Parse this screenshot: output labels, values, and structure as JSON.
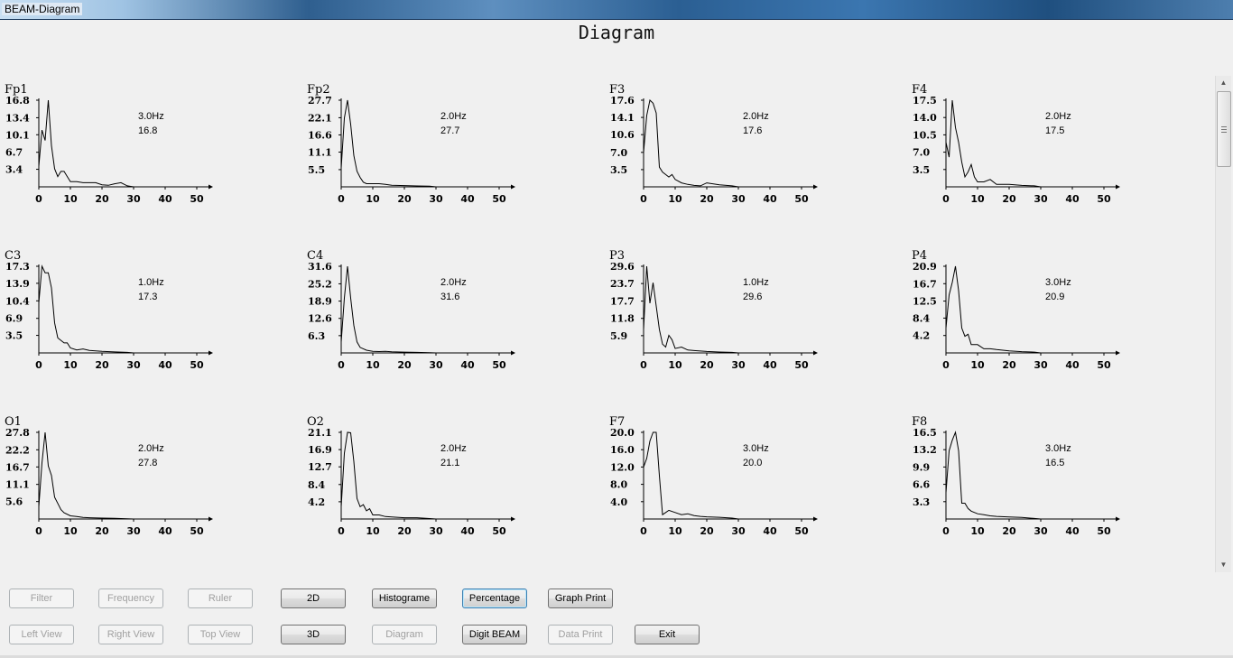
{
  "window": {
    "title": "BEAM-Diagram"
  },
  "page": {
    "title": "Diagram"
  },
  "x_tick_labels": [
    "0",
    "10",
    "20",
    "30",
    "40",
    "50"
  ],
  "chart_data": [
    {
      "type": "line",
      "channel": "Fp1",
      "peak_label": "3.0Hz",
      "peak_value": "16.8",
      "ymax": 16.8,
      "y_ticks": [
        "16.8",
        "13.4",
        "10.1",
        "6.7",
        "3.4"
      ],
      "x": [
        0,
        1,
        2,
        3,
        4,
        5,
        6,
        7,
        8,
        9,
        10,
        12,
        14,
        16,
        18,
        20,
        22,
        24,
        26,
        28,
        30
      ],
      "values": [
        4.0,
        11.0,
        9.0,
        16.8,
        8.0,
        3.5,
        2.0,
        3.0,
        3.0,
        2.0,
        1.0,
        1.0,
        0.8,
        0.8,
        0.8,
        0.4,
        0.3,
        0.6,
        0.8,
        0.2,
        0.0
      ]
    },
    {
      "type": "line",
      "channel": "Fp2",
      "peak_label": "2.0Hz",
      "peak_value": "27.7",
      "ymax": 27.7,
      "y_ticks": [
        "27.7",
        "22.1",
        "16.6",
        "11.1",
        "5.5"
      ],
      "x": [
        0,
        1,
        2,
        3,
        4,
        5,
        6,
        7,
        8,
        10,
        12,
        14,
        16,
        20,
        24,
        28,
        30
      ],
      "values": [
        6.0,
        22.0,
        27.7,
        20.0,
        10.0,
        5.0,
        3.0,
        1.5,
        1.0,
        1.0,
        1.0,
        0.8,
        0.5,
        0.4,
        0.3,
        0.2,
        0.0
      ]
    },
    {
      "type": "line",
      "channel": "F3",
      "peak_label": "2.0Hz",
      "peak_value": "17.6",
      "ymax": 17.6,
      "y_ticks": [
        "17.6",
        "14.1",
        "10.6",
        "7.0",
        "3.5"
      ],
      "x": [
        0,
        1,
        2,
        3,
        4,
        5,
        6,
        7,
        8,
        9,
        10,
        12,
        14,
        16,
        18,
        20,
        24,
        28,
        30
      ],
      "values": [
        7.0,
        14.5,
        17.6,
        17.0,
        15.0,
        4.0,
        3.0,
        2.5,
        2.0,
        2.5,
        1.5,
        0.8,
        0.5,
        0.3,
        0.2,
        0.8,
        0.4,
        0.2,
        0.0
      ]
    },
    {
      "type": "line",
      "channel": "F4",
      "peak_label": "2.0Hz",
      "peak_value": "17.5",
      "ymax": 17.5,
      "y_ticks": [
        "17.5",
        "14.0",
        "10.5",
        "7.0",
        "3.5"
      ],
      "x": [
        0,
        1,
        2,
        3,
        4,
        5,
        6,
        7,
        8,
        9,
        10,
        12,
        14,
        16,
        18,
        20,
        24,
        28,
        30
      ],
      "values": [
        9.0,
        6.0,
        17.5,
        12.0,
        9.0,
        5.0,
        2.0,
        3.0,
        4.5,
        2.0,
        1.0,
        1.0,
        1.5,
        0.5,
        0.5,
        0.5,
        0.3,
        0.2,
        0.0
      ]
    },
    {
      "type": "line",
      "channel": "C3",
      "peak_label": "1.0Hz",
      "peak_value": "17.3",
      "ymax": 17.3,
      "y_ticks": [
        "17.3",
        "13.9",
        "10.4",
        "6.9",
        "3.5"
      ],
      "x": [
        0,
        1,
        2,
        3,
        4,
        5,
        6,
        7,
        8,
        9,
        10,
        12,
        14,
        16,
        20,
        24,
        28,
        30
      ],
      "values": [
        10.0,
        17.3,
        16.0,
        16.0,
        13.0,
        6.0,
        3.0,
        2.5,
        2.0,
        2.0,
        1.0,
        0.6,
        0.8,
        0.5,
        0.3,
        0.2,
        0.1,
        0.0
      ]
    },
    {
      "type": "line",
      "channel": "C4",
      "peak_label": "2.0Hz",
      "peak_value": "31.6",
      "ymax": 31.6,
      "y_ticks": [
        "31.6",
        "25.2",
        "18.9",
        "12.6",
        "6.3"
      ],
      "x": [
        0,
        1,
        2,
        3,
        4,
        5,
        6,
        8,
        10,
        12,
        14,
        16,
        20,
        24,
        28,
        30
      ],
      "values": [
        4.0,
        20.0,
        31.6,
        20.0,
        10.0,
        4.0,
        2.0,
        1.0,
        0.6,
        0.5,
        0.6,
        0.4,
        0.3,
        0.2,
        0.1,
        0.0
      ]
    },
    {
      "type": "line",
      "channel": "P3",
      "peak_label": "1.0Hz",
      "peak_value": "29.6",
      "ymax": 29.6,
      "y_ticks": [
        "29.6",
        "23.7",
        "17.7",
        "11.8",
        "5.9"
      ],
      "x": [
        0,
        1,
        2,
        3,
        4,
        5,
        6,
        7,
        8,
        9,
        10,
        12,
        14,
        16,
        20,
        24,
        28,
        30
      ],
      "values": [
        8.0,
        29.6,
        17.0,
        24.0,
        16.0,
        8.0,
        3.0,
        2.0,
        6.0,
        4.5,
        1.5,
        2.0,
        1.0,
        0.8,
        0.5,
        0.3,
        0.2,
        0.0
      ]
    },
    {
      "type": "line",
      "channel": "P4",
      "peak_label": "3.0Hz",
      "peak_value": "20.9",
      "ymax": 20.9,
      "y_ticks": [
        "20.9",
        "16.7",
        "12.5",
        "8.4",
        "4.2"
      ],
      "x": [
        0,
        1,
        2,
        3,
        4,
        5,
        6,
        7,
        8,
        10,
        12,
        14,
        16,
        20,
        24,
        28,
        30
      ],
      "values": [
        6.0,
        14.0,
        17.0,
        20.9,
        15.0,
        6.0,
        4.0,
        4.5,
        2.0,
        2.0,
        1.0,
        1.0,
        0.8,
        0.5,
        0.3,
        0.2,
        0.0
      ]
    },
    {
      "type": "line",
      "channel": "O1",
      "peak_label": "2.0Hz",
      "peak_value": "27.8",
      "ymax": 27.8,
      "y_ticks": [
        "27.8",
        "22.2",
        "16.7",
        "11.1",
        "5.6"
      ],
      "x": [
        0,
        1,
        2,
        3,
        4,
        5,
        6,
        7,
        8,
        10,
        12,
        14,
        16,
        20,
        24,
        28,
        30
      ],
      "values": [
        4.0,
        18.0,
        27.8,
        17.0,
        14.0,
        7.0,
        5.0,
        3.0,
        2.0,
        1.0,
        0.8,
        0.5,
        0.4,
        0.3,
        0.2,
        0.1,
        0.0
      ]
    },
    {
      "type": "line",
      "channel": "O2",
      "peak_label": "2.0Hz",
      "peak_value": "21.1",
      "ymax": 21.1,
      "y_ticks": [
        "21.1",
        "16.9",
        "12.7",
        "8.4",
        "4.2"
      ],
      "x": [
        0,
        1,
        2,
        3,
        4,
        5,
        6,
        7,
        8,
        9,
        10,
        12,
        14,
        16,
        20,
        24,
        28,
        30
      ],
      "values": [
        3.0,
        16.0,
        21.1,
        21.0,
        14.0,
        5.0,
        3.0,
        3.5,
        2.0,
        2.5,
        1.0,
        1.0,
        0.6,
        0.5,
        0.3,
        0.3,
        0.1,
        0.0
      ]
    },
    {
      "type": "line",
      "channel": "F7",
      "peak_label": "3.0Hz",
      "peak_value": "20.0",
      "ymax": 20.0,
      "y_ticks": [
        "20.0",
        "16.0",
        "12.0",
        "8.0",
        "4.0"
      ],
      "x": [
        0,
        1,
        2,
        3,
        4,
        5,
        6,
        7,
        8,
        10,
        12,
        14,
        16,
        18,
        20,
        24,
        28,
        30
      ],
      "values": [
        12.0,
        14.0,
        18.0,
        20.0,
        20.0,
        10.0,
        1.0,
        1.5,
        2.0,
        1.5,
        1.0,
        1.2,
        0.8,
        0.6,
        0.5,
        0.4,
        0.2,
        0.0
      ]
    },
    {
      "type": "line",
      "channel": "F8",
      "peak_label": "3.0Hz",
      "peak_value": "16.5",
      "ymax": 16.5,
      "y_ticks": [
        "16.5",
        "13.2",
        "9.9",
        "6.6",
        "3.3"
      ],
      "x": [
        0,
        1,
        2,
        3,
        4,
        5,
        6,
        7,
        8,
        10,
        12,
        14,
        16,
        20,
        24,
        28,
        30
      ],
      "values": [
        5.0,
        13.0,
        15.0,
        16.5,
        13.0,
        3.0,
        3.0,
        2.0,
        1.5,
        1.0,
        0.8,
        0.6,
        0.5,
        0.4,
        0.3,
        0.1,
        0.0
      ]
    }
  ],
  "buttons": {
    "row1": [
      {
        "id": "filter",
        "label": "Filter",
        "state": "disabled"
      },
      {
        "id": "frequency",
        "label": "Frequency",
        "state": "disabled"
      },
      {
        "id": "ruler",
        "label": "Ruler",
        "state": "disabled"
      },
      {
        "id": "2d",
        "label": "2D",
        "state": "enabled"
      },
      {
        "id": "histograme",
        "label": "Histograme",
        "state": "enabled"
      },
      {
        "id": "percentage",
        "label": "Percentage",
        "state": "focused"
      },
      {
        "id": "graph-print",
        "label": "Graph Print",
        "state": "enabled"
      }
    ],
    "row2": [
      {
        "id": "left-view",
        "label": "Left View",
        "state": "disabled"
      },
      {
        "id": "right-view",
        "label": "Right View",
        "state": "disabled"
      },
      {
        "id": "top-view",
        "label": "Top View",
        "state": "disabled"
      },
      {
        "id": "3d",
        "label": "3D",
        "state": "enabled"
      },
      {
        "id": "diagram",
        "label": "Diagram",
        "state": "disabled"
      },
      {
        "id": "digit-beam",
        "label": "Digit BEAM",
        "state": "enabled"
      },
      {
        "id": "data-print",
        "label": "Data Print",
        "state": "disabled"
      },
      {
        "id": "exit",
        "label": "Exit",
        "state": "enabled"
      }
    ]
  }
}
